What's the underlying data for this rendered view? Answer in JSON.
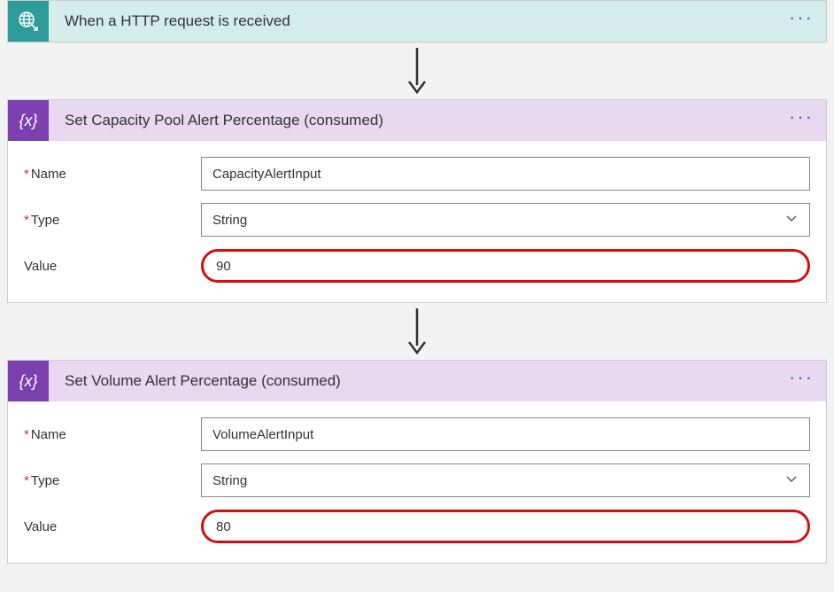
{
  "trigger": {
    "title": "When a HTTP request is received",
    "icon_name": "http-request-icon",
    "menu": "···"
  },
  "action1": {
    "title": "Set Capacity Pool Alert Percentage (consumed)",
    "icon_text": "{x}",
    "menu": "···",
    "fields": {
      "name_label": "Name",
      "name_value": "CapacityAlertInput",
      "type_label": "Type",
      "type_value": "String",
      "value_label": "Value",
      "value_value": "90"
    }
  },
  "action2": {
    "title": "Set Volume Alert Percentage (consumed)",
    "icon_text": "{x}",
    "menu": "···",
    "fields": {
      "name_label": "Name",
      "name_value": "VolumeAlertInput",
      "type_label": "Type",
      "type_value": "String",
      "value_label": "Value",
      "value_value": "80"
    }
  }
}
